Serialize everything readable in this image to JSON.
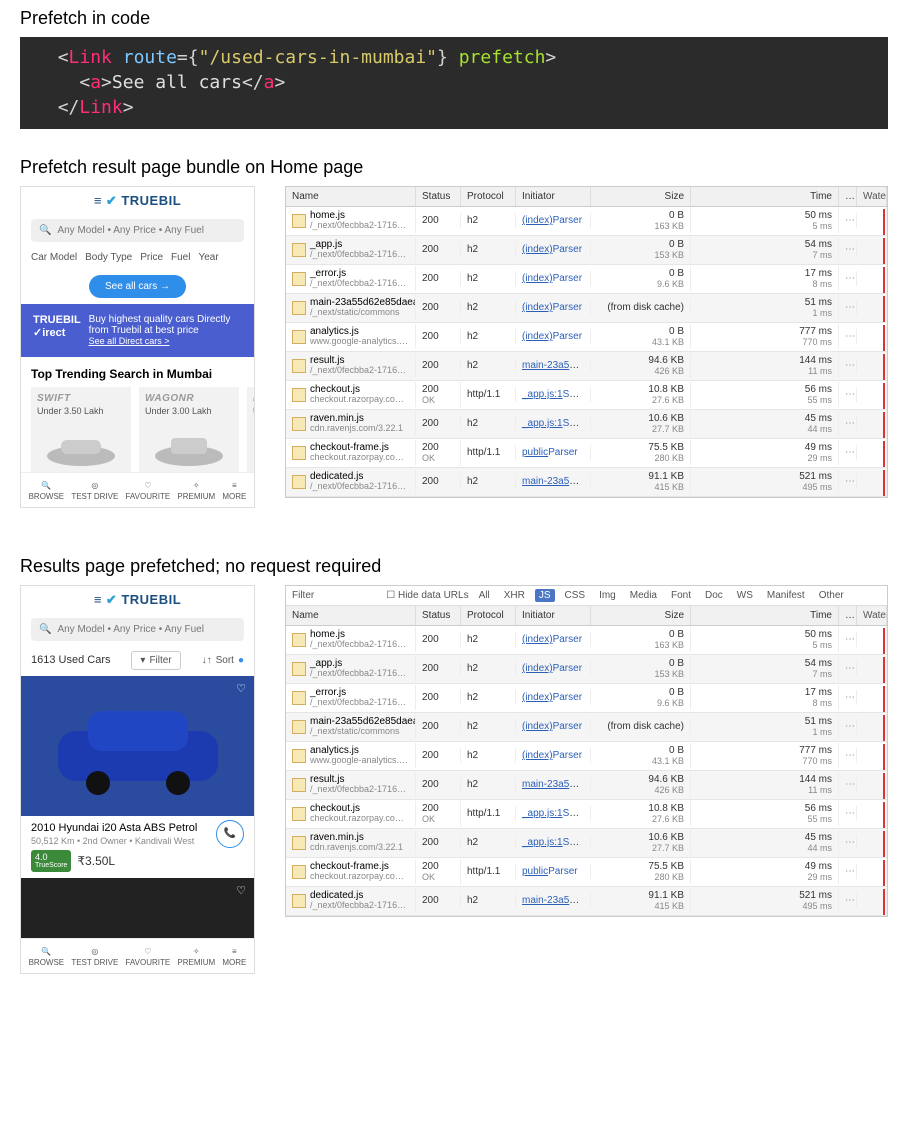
{
  "sections": {
    "s1": "Prefetch in code",
    "s2": "Prefetch result page bundle on Home page",
    "s3": "Results page prefetched; no request required"
  },
  "code": {
    "l1_open": "<",
    "l1_Link": "Link",
    "l1_sp": " ",
    "l1_route": "route",
    "l1_eq": "=",
    "l1_lb": "{",
    "l1_str": "\"/used-cars-in-mumbai\"",
    "l1_rb": "}",
    "l1_prefetch": "prefetch",
    "l1_close": ">",
    "l2_open": "<",
    "l2_a": "a",
    "l2_close1": ">",
    "l2_text": "See all cars",
    "l2_close2": "</",
    "l2_close3": ">",
    "l3_open": "</",
    "l3_Link": "Link",
    "l3_close": ">"
  },
  "phone1": {
    "brand": "TRUEBIL",
    "search_placeholder": "Any Model • Any Price • Any Fuel",
    "pills": [
      "Car Model",
      "Body Type",
      "Price",
      "Fuel",
      "Year"
    ],
    "see_all": "See all cars →",
    "promo_brand1": "TRUEBIL",
    "promo_brand2": "✓irect",
    "promo_text": "Buy highest quality cars Directly from Truebil at best price",
    "promo_link": "See all Direct cars >",
    "trending": "Top Trending Search in Mumbai",
    "cards": [
      {
        "name": "SWIFT",
        "sub": "Under 3.50 Lakh"
      },
      {
        "name": "WAGONR",
        "sub": "Under 3.00 Lakh"
      },
      {
        "name": "B",
        "sub": "Unde"
      }
    ],
    "tabs": [
      "BROWSE",
      "TEST DRIVE",
      "FAVOURITE",
      "PREMIUM",
      "MORE"
    ]
  },
  "phone2": {
    "count": "1613 Used Cars",
    "filter": "Filter",
    "sort": "Sort",
    "listing_title": "2010 Hyundai i20 Asta ABS Petrol",
    "listing_sub": "50,512 Km • 2nd Owner • Kandivali West",
    "badge_val": "4.0",
    "badge_lbl": "TrueScore",
    "price": "₹3.50L"
  },
  "devtools": {
    "filter": "Filter",
    "hide": "Hide data URLs",
    "chips": [
      "All",
      "XHR",
      "JS",
      "CSS",
      "Img",
      "Media",
      "Font",
      "Doc",
      "WS",
      "Manifest",
      "Other"
    ],
    "head": {
      "name": "Name",
      "status": "Status",
      "protocol": "Protocol",
      "initiator": "Initiator",
      "size": "Size",
      "time": "Time",
      "wat": "Wate"
    },
    "rows": [
      {
        "n1": "home.js",
        "n2": "/_next/0fecbba2-1716-4…",
        "status": "200",
        "proto": "h2",
        "i1": "(index)",
        "i2": "Parser",
        "s1": "0 B",
        "s2": "163 KB",
        "t1": "50 ms",
        "t2": "5 ms"
      },
      {
        "n1": "_app.js",
        "n2": "/_next/0fecbba2-1716-4…",
        "status": "200",
        "proto": "h2",
        "i1": "(index)",
        "i2": "Parser",
        "s1": "0 B",
        "s2": "153 KB",
        "t1": "54 ms",
        "t2": "7 ms"
      },
      {
        "n1": "_error.js",
        "n2": "/_next/0fecbba2-1716-4…",
        "status": "200",
        "proto": "h2",
        "i1": "(index)",
        "i2": "Parser",
        "s1": "0 B",
        "s2": "9.6 KB",
        "t1": "17 ms",
        "t2": "8 ms"
      },
      {
        "n1": "main-23a55d62e85daea…",
        "n2": "/_next/static/commons",
        "status": "200",
        "proto": "h2",
        "i1": "(index)",
        "i2": "Parser",
        "s1": "(from disk cache)",
        "s2": "",
        "t1": "51 ms",
        "t2": "1 ms"
      },
      {
        "n1": "analytics.js",
        "n2": "www.google-analytics.c…",
        "status": "200",
        "proto": "h2",
        "i1": "(index)",
        "i2": "Parser",
        "s1": "0 B",
        "s2": "43.1 KB",
        "t1": "777 ms",
        "t2": "770 ms"
      },
      {
        "n1": "result.js",
        "n2": "/_next/0fecbba2-1716-4…",
        "status": "200",
        "proto": "h2",
        "i1": "main-23a55…",
        "i2": "Script",
        "s1": "94.6 KB",
        "s2": "426 KB",
        "t1": "144 ms",
        "t2": "11 ms"
      },
      {
        "n1": "checkout.js",
        "n2": "checkout.razorpay.com/v1",
        "status": "200",
        "status2": "OK",
        "proto": "http/1.1",
        "i1": "_app.js:1",
        "i2": "Script",
        "s1": "10.8 KB",
        "s2": "27.6 KB",
        "t1": "56 ms",
        "t2": "55 ms"
      },
      {
        "n1": "raven.min.js",
        "n2": "cdn.ravenjs.com/3.22.1",
        "status": "200",
        "proto": "h2",
        "i1": "_app.js:1",
        "i2": "Script",
        "s1": "10.6 KB",
        "s2": "27.7 KB",
        "t1": "45 ms",
        "t2": "44 ms"
      },
      {
        "n1": "checkout-frame.js",
        "n2": "checkout.razorpay.com/v1",
        "status": "200",
        "status2": "OK",
        "proto": "http/1.1",
        "i1": "public",
        "i2": "Parser",
        "s1": "75.5 KB",
        "s2": "280 KB",
        "t1": "49 ms",
        "t2": "29 ms"
      },
      {
        "n1": "dedicated.js",
        "n2": "/_next/0fecbba2-1716-4…",
        "status": "200",
        "proto": "h2",
        "i1": "main-23a55…",
        "i2": "Script",
        "s1": "91.1 KB",
        "s2": "415 KB",
        "t1": "521 ms",
        "t2": "495 ms"
      }
    ]
  }
}
